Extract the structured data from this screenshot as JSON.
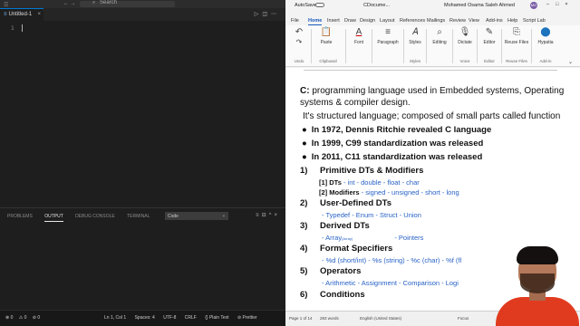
{
  "vscode": {
    "search_label": "Search",
    "tab_label": "Untitled-1",
    "line_number": "1",
    "panel_tabs": [
      "PROBLEMS",
      "OUTPUT",
      "DEBUG CONSOLE",
      "TERMINAL"
    ],
    "output_select": "Code",
    "status_left": [
      "⊗ 0",
      "⚠ 0",
      "⊘ 0"
    ],
    "status_right": [
      "Ln 1, Col 1",
      "Spaces: 4",
      "UTF-8",
      "CRLF",
      "{} Plain Text",
      "⊘ Prettier"
    ]
  },
  "word": {
    "autosave": "AutoSave",
    "toggle": "Off",
    "doc_title": "CDocume...",
    "user_name": "Mohamed Osama Saleh Ahmed",
    "user_initials": "MO",
    "menu": [
      "File",
      "Home",
      "Insert",
      "Draw",
      "Design",
      "Layout",
      "References",
      "Mailings",
      "Review",
      "View",
      "Add-ins",
      "Help",
      "Script Lab"
    ],
    "ribbon": {
      "undo": "Undo",
      "paste": "Paste",
      "clipboard": "Clipboard",
      "font": "Font",
      "paragraph": "Paragraph",
      "styles": "Styles",
      "styles_group": "Styles",
      "editing": "Editing",
      "dictate": "Dictate",
      "voice": "Voice",
      "editor": "Editor",
      "editor_group": "Editor",
      "reuse_files": "Reuse Files",
      "reuse_files_group": "Reuse Files",
      "hypatia": "Hypatia",
      "addins_group": "Add-in"
    },
    "doc": {
      "intro_bold": "C:",
      "intro_text": " programming language used in Embedded systems, Operating",
      "intro_line2": "systems & compiler design.",
      "intro_line3": "It's structured language; composed of small parts called function",
      "bullets": [
        "In 1972, Dennis Ritchie revealed C language",
        "In 1999, C99 standardization was released",
        "In 2011, C11 standardization was released"
      ],
      "sections": [
        {
          "num": "1)",
          "title": "Primitive DTs & Modifiers"
        },
        {
          "num": "2)",
          "title": "User-Defined DTs"
        },
        {
          "num": "3)",
          "title": "Derived DTs"
        },
        {
          "num": "4)",
          "title": "Format Specifiers"
        },
        {
          "num": "5)",
          "title": "Operators"
        },
        {
          "num": "6)",
          "title": "Conditions"
        }
      ],
      "s1_line1": {
        "label": "[1] DTs",
        "items": "- int      - double    - float    - char"
      },
      "s1_line2": {
        "label": "[2] Modifiers",
        "items": "- signed   - unsigned   - short   - long"
      },
      "s2_items": "- Typedef            - Enum             - Struct             - Union",
      "s3_item1": "- Array",
      "s3_item1_small": "(Array)",
      "s3_item2": "- Pointers",
      "s4_items": "- %d (short/int)      - %s (string)        - %c (char)          - %f (fl",
      "s5_items": "- Arithmetic          - Assignment          - Comparison         - Logi"
    },
    "status": {
      "page": "Page 1 of 14",
      "words": "283 words",
      "language": "English (United States)",
      "focus": "Focus",
      "zoom": "100%"
    }
  },
  "colors": {
    "vscode_bg": "#1e1e1e",
    "vscode_accent": "#0078d4",
    "word_accent": "#185abd",
    "link_blue": "#2862c6",
    "presenter_shirt": "#e13b1f"
  }
}
